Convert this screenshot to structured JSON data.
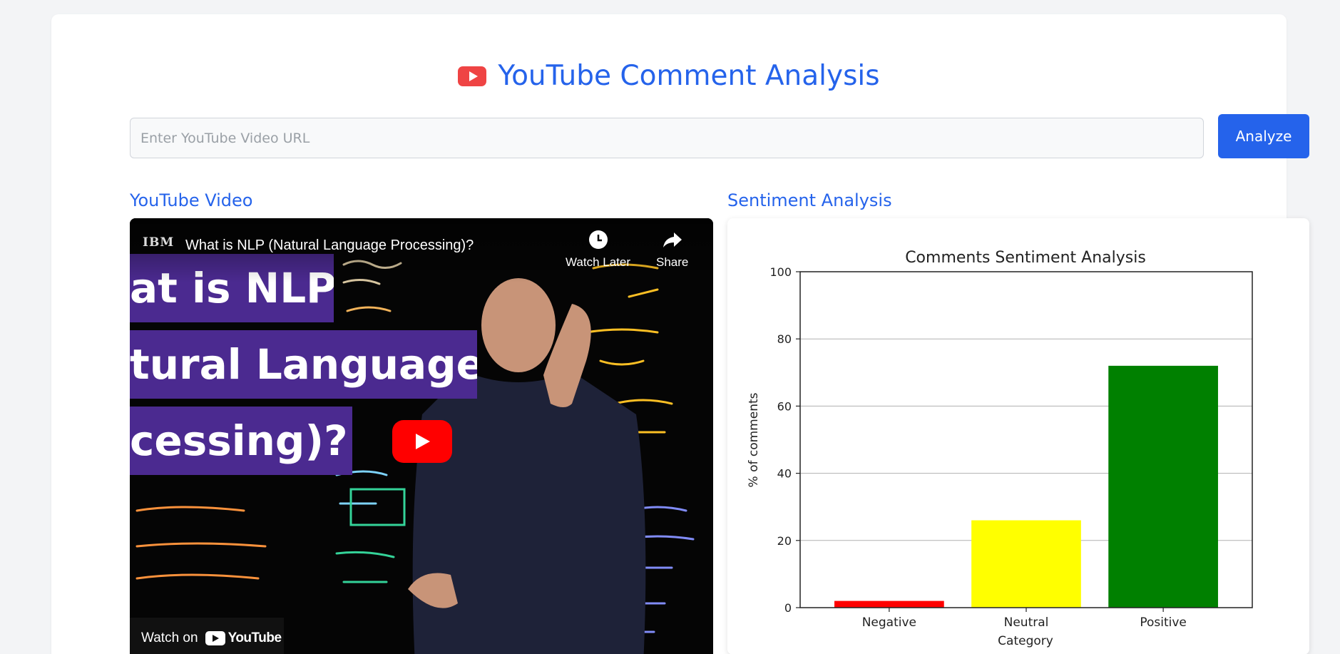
{
  "header": {
    "title": "YouTube Comment Analysis",
    "logo_icon": "youtube-logo-icon",
    "accent_color": "#2563eb"
  },
  "search": {
    "placeholder": "Enter YouTube Video URL",
    "value": "",
    "button_label": "Analyze"
  },
  "video_section": {
    "heading": "YouTube Video",
    "player": {
      "channel": "IBM",
      "title": "What is NLP (Natural Language Processing)?",
      "watch_later_label": "Watch Later",
      "share_label": "Share",
      "watch_on_label": "Watch on",
      "youtube_label": "YouTube",
      "thumbnail_lines": [
        "at is NLP",
        "tural Language",
        "cessing)?"
      ]
    }
  },
  "sentiment_section": {
    "heading": "Sentiment Analysis"
  },
  "chart_data": {
    "type": "bar",
    "title": "Comments Sentiment Analysis",
    "xlabel": "Category",
    "ylabel": "% of comments",
    "categories": [
      "Negative",
      "Neutral",
      "Positive"
    ],
    "values": [
      2,
      26,
      72
    ],
    "colors": [
      "#ff0000",
      "#ffff00",
      "#008000"
    ],
    "ylim": [
      0,
      100
    ],
    "yticks": [
      "0",
      "20",
      "40",
      "60",
      "80",
      "100"
    ],
    "grid": true
  }
}
